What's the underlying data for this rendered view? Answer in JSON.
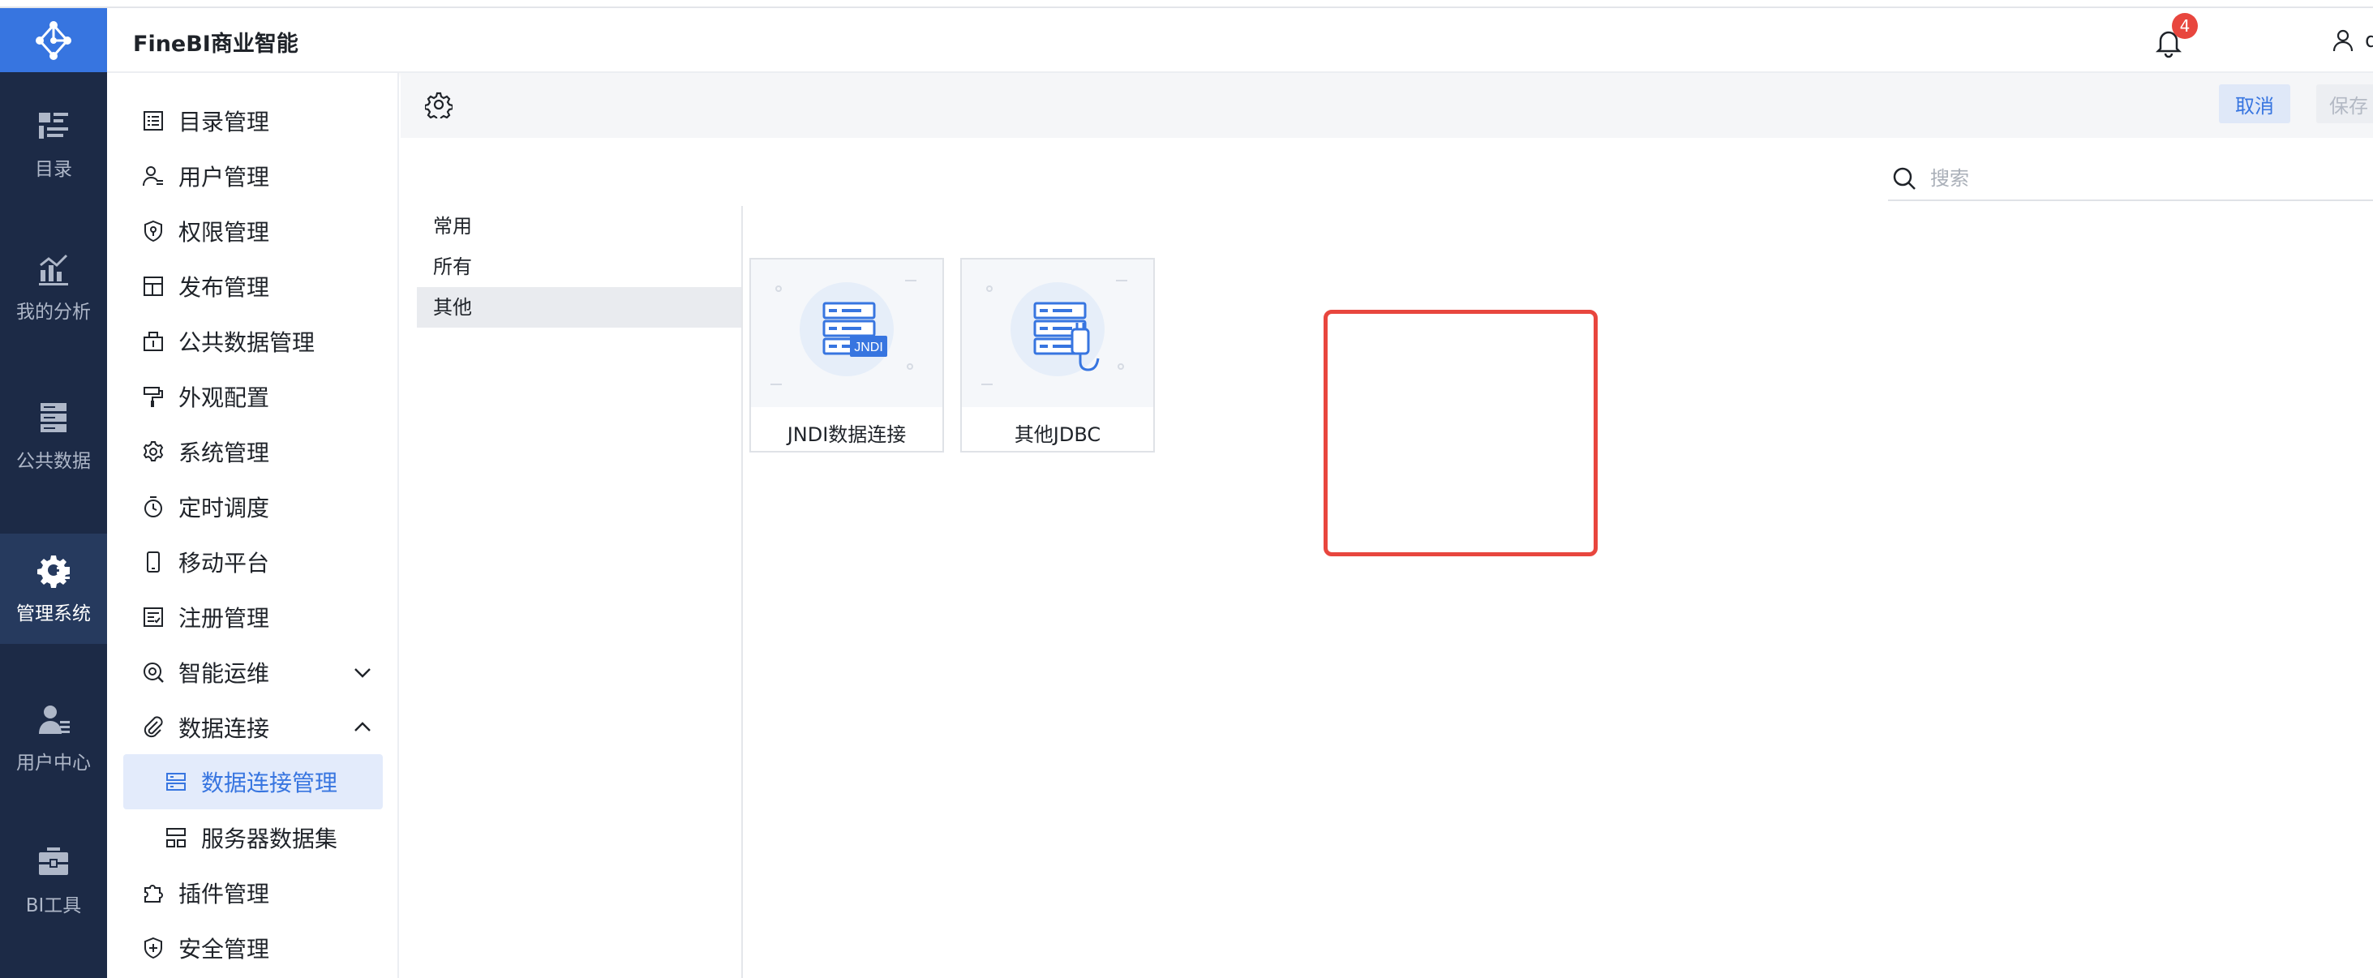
{
  "app": {
    "title": "FineBI商业智能"
  },
  "rail": {
    "items": [
      {
        "label": "目录",
        "icon": "catalog-icon"
      },
      {
        "label": "我的分析",
        "icon": "analysis-chart-icon"
      },
      {
        "label": "公共数据",
        "icon": "database-icon"
      },
      {
        "label": "管理系统",
        "icon": "admin-gear-icon",
        "active": true
      },
      {
        "label": "用户中心",
        "icon": "user-center-icon"
      },
      {
        "label": "BI工具",
        "icon": "toolbox-icon"
      }
    ]
  },
  "header": {
    "notifications": {
      "count": "4"
    },
    "user": {
      "name": "qiliang"
    }
  },
  "sidebar": {
    "items": [
      {
        "label": "目录管理"
      },
      {
        "label": "用户管理"
      },
      {
        "label": "权限管理"
      },
      {
        "label": "发布管理"
      },
      {
        "label": "公共数据管理"
      },
      {
        "label": "外观配置"
      },
      {
        "label": "系统管理"
      },
      {
        "label": "定时调度"
      },
      {
        "label": "移动平台"
      },
      {
        "label": "注册管理"
      },
      {
        "label": "智能运维"
      },
      {
        "label": "数据连接"
      },
      {
        "label": "数据连接管理",
        "active": true
      },
      {
        "label": "服务器数据集"
      },
      {
        "label": "插件管理"
      },
      {
        "label": "安全管理"
      }
    ]
  },
  "toolbar": {
    "cancel_label": "取消",
    "save_label": "保存"
  },
  "search": {
    "placeholder": "搜索"
  },
  "categories": [
    {
      "label": "常用"
    },
    {
      "label": "所有"
    },
    {
      "label": "其他",
      "active": true
    }
  ],
  "cards": [
    {
      "label": "JNDI数据连接",
      "badge": "JNDI"
    },
    {
      "label": "其他JDBC"
    }
  ],
  "colors": {
    "accent": "#3775e0",
    "rail": "#1c2a46",
    "highlight": "#e8463e"
  }
}
